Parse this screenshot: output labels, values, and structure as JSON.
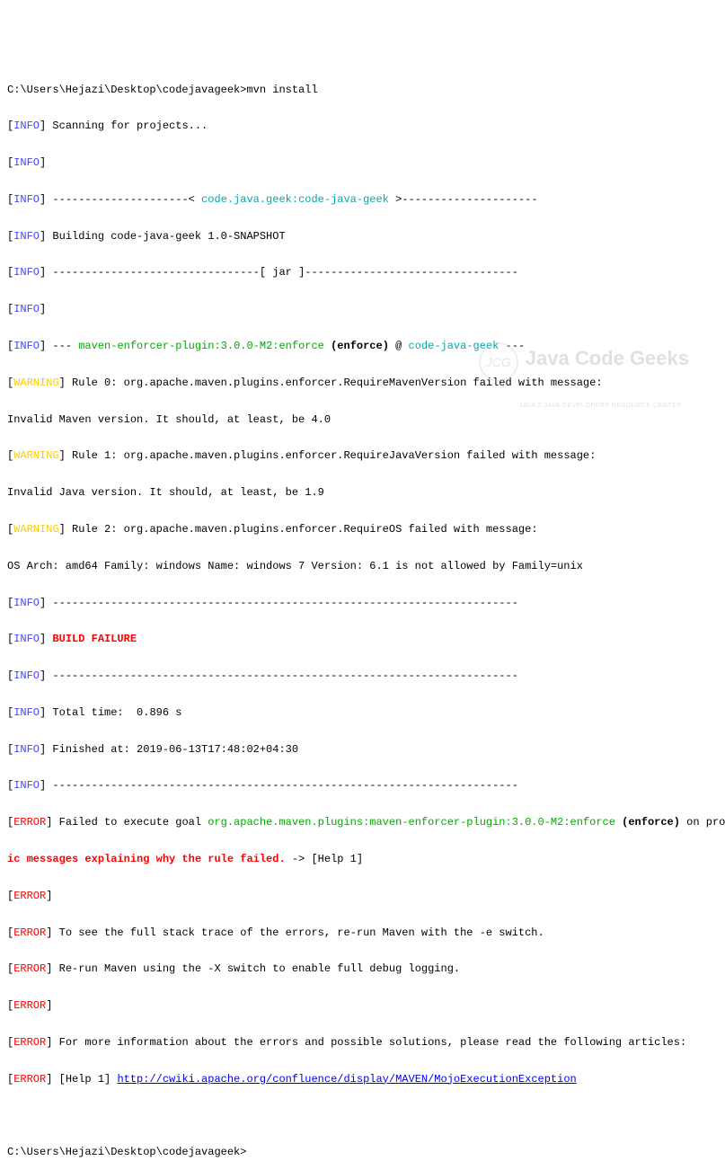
{
  "prompt1": "C:\\Users\\Hejazi\\Desktop\\codejavageek>mvn install",
  "prompt2": "C:\\Users\\Hejazi\\Desktop\\codejavageek>",
  "lines": {
    "scanning": " Scanning for projects...",
    "dashes_pre": " ---------------------< ",
    "project_id": "code.java.geek:code-java-geek",
    "dashes_post": " >---------------------",
    "building": " Building code-java-geek 1.0-SNAPSHOT",
    "jar_line": " --------------------------------[ jar ]---------------------------------",
    "plugin_pre": " --- ",
    "plugin_name": "maven-enforcer-plugin:3.0.0-M2:enforce",
    "plugin_enforce": " (enforce)",
    "plugin_at": " @ ",
    "plugin_proj": "code-java-geek",
    "plugin_end": " ---",
    "warn0": " Rule 0: org.apache.maven.plugins.enforcer.RequireMavenVersion failed with message:",
    "warn0_msg": "Invalid Maven version. It should, at least, be 4.0",
    "warn1": " Rule 1: org.apache.maven.plugins.enforcer.RequireJavaVersion failed with message:",
    "warn1_msg": "Invalid Java version. It should, at least, be 1.9",
    "warn2": " Rule 2: org.apache.maven.plugins.enforcer.RequireOS failed with message:",
    "warn2_msg": "OS Arch: amd64 Family: windows Name: windows 7 Version: 6.1 is not allowed by Family=unix",
    "hr": " ------------------------------------------------------------------------",
    "build_failure": " BUILD FAILURE",
    "total_time": " Total time:  0.896 s",
    "finished": " Finished at: 2019-06-13T17:48:02+04:30",
    "err_fail_pre": " Failed to execute goal ",
    "err_fail_goal": "org.apache.maven.plugins:maven-enforcer-plugin:3.0.0-M2:enforce",
    "err_fail_enforce": " (enforce)",
    "err_fail_post": " on project",
    "err_fail_line2": "ic messages explaining why the rule failed.",
    "err_fail_help": " -> [Help 1]",
    "err_stacktrace": " To see the full stack trace of the errors, re-run Maven with the -e switch.",
    "err_rerun": " Re-run Maven using the -X switch to enable full debug logging.",
    "err_moreinfo": " For more information about the errors and possible solutions, please read the following articles:",
    "err_help1_pre": " [Help 1] ",
    "err_help1_link": "http://cwiki.apache.org/confluence/display/MAVEN/MojoExecutionException"
  },
  "tags": {
    "info": "INFO",
    "warning": "WARNING",
    "error": "ERROR"
  },
  "watermark": {
    "circle": "JCG",
    "main": "Java Code Geeks",
    "sub": "JAVA 2 JAVA DEVELOPERS RESOURCE CENTER"
  }
}
